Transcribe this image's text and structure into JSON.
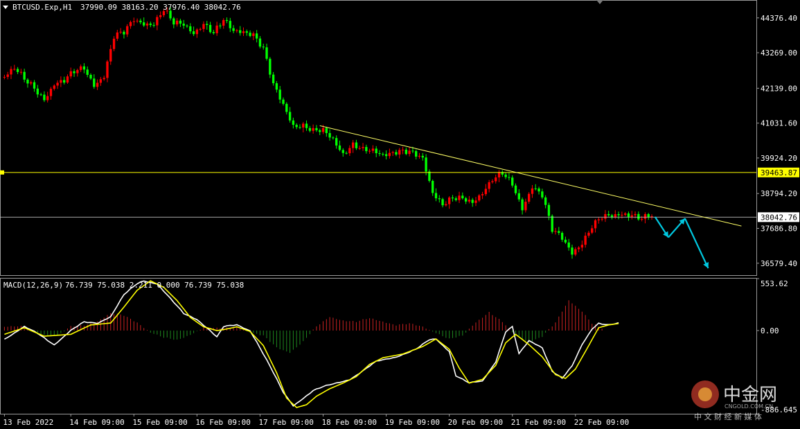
{
  "header": {
    "symbol_title": "BTCUSD.Exp,H1",
    "ohlc": "37990.09 38163.20 37976.40 38042.76",
    "macd_title": "MACD(12,26,9)",
    "macd_values": "76.739 75.038 2.211 0.000 76.739 75.038"
  },
  "price_axis": {
    "ticks": [
      "44376.40",
      "43269.00",
      "42139.00",
      "41031.60",
      "39924.20",
      "38794.20",
      "37686.80",
      "36579.40"
    ],
    "hline_label": "39463.87",
    "current_label": "38042.76"
  },
  "macd_axis": {
    "ticks": [
      "553.62",
      "0.00",
      "-886.645"
    ]
  },
  "time_axis": {
    "labels": [
      "13 Feb 2022",
      "14 Feb 09:00",
      "15 Feb 09:00",
      "16 Feb 09:00",
      "17 Feb 09:00",
      "18 Feb 09:00",
      "19 Feb 09:00",
      "20 Feb 09:00",
      "21 Feb 09:00",
      "22 Feb 09:00"
    ]
  },
  "watermark": {
    "name": "中金网",
    "domain": "CNGOLD.COM.CN",
    "tagline": "中 文 财 经 新 媒 体"
  },
  "colors": {
    "up": "#ff0000",
    "down": "#00ff00",
    "trendline": "#ffff66",
    "hline": "#ffff00",
    "arrow": "#00c8e0",
    "macd_line": "#ffffff",
    "signal_line": "#ffff00",
    "hist_pos": "#cc2222",
    "hist_neg": "#1f8a1f"
  },
  "chart_data": {
    "type": "candlestick",
    "price_range": [
      36200,
      44900
    ],
    "macd_range": [
      -886.645,
      553.62
    ],
    "price_path": [
      [
        0,
        42500
      ],
      [
        3,
        42700
      ],
      [
        6,
        42400
      ],
      [
        9,
        42200
      ],
      [
        12,
        41850
      ],
      [
        15,
        42250
      ],
      [
        18,
        42300
      ],
      [
        21,
        42650
      ],
      [
        24,
        42850
      ],
      [
        27,
        42300
      ],
      [
        30,
        42500
      ],
      [
        33,
        43700
      ],
      [
        36,
        43900
      ],
      [
        39,
        44400
      ],
      [
        42,
        44250
      ],
      [
        45,
        44150
      ],
      [
        48,
        44550
      ],
      [
        51,
        44200
      ],
      [
        54,
        44250
      ],
      [
        57,
        43950
      ],
      [
        60,
        44150
      ],
      [
        63,
        43800
      ],
      [
        66,
        44300
      ],
      [
        69,
        44050
      ],
      [
        72,
        44000
      ],
      [
        75,
        43800
      ],
      [
        78,
        43300
      ],
      [
        81,
        42250
      ],
      [
        84,
        41700
      ],
      [
        87,
        41000
      ],
      [
        90,
        40900
      ],
      [
        93,
        40700
      ],
      [
        96,
        40800
      ],
      [
        99,
        40600
      ],
      [
        102,
        40100
      ],
      [
        105,
        40300
      ],
      [
        108,
        40100
      ],
      [
        111,
        40150
      ],
      [
        114,
        40100
      ],
      [
        117,
        40150
      ],
      [
        120,
        40100
      ],
      [
        123,
        40000
      ],
      [
        126,
        39900
      ],
      [
        129,
        38900
      ],
      [
        132,
        38500
      ],
      [
        135,
        38600
      ],
      [
        138,
        38550
      ],
      [
        141,
        38500
      ],
      [
        144,
        38900
      ],
      [
        147,
        39300
      ],
      [
        150,
        39400
      ],
      [
        153,
        39000
      ],
      [
        156,
        38300
      ],
      [
        159,
        39100
      ],
      [
        162,
        38800
      ],
      [
        165,
        37600
      ],
      [
        168,
        37300
      ],
      [
        171,
        36900
      ],
      [
        174,
        37300
      ],
      [
        177,
        37800
      ],
      [
        180,
        38000
      ],
      [
        183,
        38000
      ],
      [
        186,
        38150
      ],
      [
        189,
        38200
      ],
      [
        192,
        38050
      ],
      [
        195,
        38042
      ]
    ],
    "trendline": [
      [
        95,
        40950
      ],
      [
        222,
        37760
      ]
    ],
    "horizontal_levels": [
      39463.87,
      38042.76
    ],
    "projection_arrows": [
      [
        [
          196,
          38050
        ],
        [
          200,
          37400
        ]
      ],
      [
        [
          200,
          37400
        ],
        [
          205,
          38000
        ]
      ],
      [
        [
          205,
          38000
        ],
        [
          212,
          36420
        ]
      ]
    ],
    "macd": [
      [
        0,
        -90
      ],
      [
        6,
        40
      ],
      [
        10,
        -30
      ],
      [
        15,
        -150
      ],
      [
        20,
        0
      ],
      [
        24,
        90
      ],
      [
        28,
        80
      ],
      [
        32,
        150
      ],
      [
        36,
        380
      ],
      [
        40,
        500
      ],
      [
        42,
        530
      ],
      [
        46,
        500
      ],
      [
        50,
        340
      ],
      [
        54,
        180
      ],
      [
        58,
        120
      ],
      [
        62,
        0
      ],
      [
        64,
        -70
      ],
      [
        66,
        40
      ],
      [
        70,
        60
      ],
      [
        74,
        0
      ],
      [
        76,
        -120
      ],
      [
        80,
        -380
      ],
      [
        84,
        -660
      ],
      [
        87,
        -800
      ],
      [
        90,
        -720
      ],
      [
        93,
        -640
      ],
      [
        96,
        -600
      ],
      [
        100,
        -560
      ],
      [
        104,
        -520
      ],
      [
        108,
        -430
      ],
      [
        112,
        -330
      ],
      [
        118,
        -280
      ],
      [
        124,
        -200
      ],
      [
        128,
        -100
      ],
      [
        130,
        -90
      ],
      [
        134,
        -220
      ],
      [
        136,
        -480
      ],
      [
        140,
        -560
      ],
      [
        144,
        -540
      ],
      [
        148,
        -330
      ],
      [
        151,
        -10
      ],
      [
        153,
        40
      ],
      [
        155,
        -250
      ],
      [
        158,
        -110
      ],
      [
        162,
        -180
      ],
      [
        165,
        -430
      ],
      [
        168,
        -510
      ],
      [
        171,
        -380
      ],
      [
        174,
        -150
      ],
      [
        177,
        20
      ],
      [
        179,
        80
      ],
      [
        182,
        60
      ],
      [
        185,
        77
      ]
    ],
    "signal": [
      [
        0,
        -40
      ],
      [
        6,
        30
      ],
      [
        12,
        -60
      ],
      [
        20,
        -40
      ],
      [
        26,
        60
      ],
      [
        32,
        80
      ],
      [
        36,
        250
      ],
      [
        40,
        430
      ],
      [
        44,
        530
      ],
      [
        48,
        460
      ],
      [
        52,
        320
      ],
      [
        56,
        140
      ],
      [
        60,
        40
      ],
      [
        64,
        0
      ],
      [
        66,
        10
      ],
      [
        70,
        40
      ],
      [
        74,
        -10
      ],
      [
        78,
        -160
      ],
      [
        82,
        -450
      ],
      [
        85,
        -720
      ],
      [
        88,
        -820
      ],
      [
        91,
        -790
      ],
      [
        94,
        -700
      ],
      [
        98,
        -620
      ],
      [
        102,
        -560
      ],
      [
        106,
        -490
      ],
      [
        110,
        -360
      ],
      [
        114,
        -290
      ],
      [
        120,
        -250
      ],
      [
        126,
        -170
      ],
      [
        130,
        -90
      ],
      [
        134,
        -200
      ],
      [
        137,
        -400
      ],
      [
        140,
        -560
      ],
      [
        144,
        -520
      ],
      [
        148,
        -370
      ],
      [
        151,
        -130
      ],
      [
        154,
        -40
      ],
      [
        158,
        -150
      ],
      [
        162,
        -280
      ],
      [
        166,
        -470
      ],
      [
        169,
        -510
      ],
      [
        172,
        -410
      ],
      [
        176,
        -160
      ],
      [
        179,
        30
      ],
      [
        182,
        60
      ],
      [
        185,
        75
      ]
    ],
    "histogram": [
      [
        0,
        40
      ],
      [
        6,
        40
      ],
      [
        10,
        -30
      ],
      [
        12,
        -40
      ],
      [
        16,
        -60
      ],
      [
        20,
        40
      ],
      [
        24,
        60
      ],
      [
        28,
        100
      ],
      [
        32,
        180
      ],
      [
        36,
        160
      ],
      [
        40,
        90
      ],
      [
        44,
        -20
      ],
      [
        48,
        -80
      ],
      [
        52,
        -100
      ],
      [
        56,
        -40
      ],
      [
        60,
        30
      ],
      [
        64,
        20
      ],
      [
        70,
        40
      ],
      [
        74,
        -20
      ],
      [
        78,
        -60
      ],
      [
        82,
        -180
      ],
      [
        86,
        -230
      ],
      [
        90,
        -120
      ],
      [
        94,
        40
      ],
      [
        98,
        150
      ],
      [
        102,
        110
      ],
      [
        106,
        90
      ],
      [
        110,
        130
      ],
      [
        114,
        100
      ],
      [
        118,
        60
      ],
      [
        122,
        70
      ],
      [
        126,
        40
      ],
      [
        130,
        -20
      ],
      [
        134,
        -90
      ],
      [
        138,
        -60
      ],
      [
        142,
        90
      ],
      [
        146,
        200
      ],
      [
        150,
        90
      ],
      [
        154,
        -60
      ],
      [
        158,
        -120
      ],
      [
        162,
        -60
      ],
      [
        166,
        80
      ],
      [
        170,
        320
      ],
      [
        174,
        210
      ],
      [
        177,
        80
      ],
      [
        180,
        20
      ]
    ],
    "time_labels_at_bar": [
      0,
      20,
      39,
      58,
      77,
      96,
      115,
      134,
      153,
      172
    ]
  }
}
